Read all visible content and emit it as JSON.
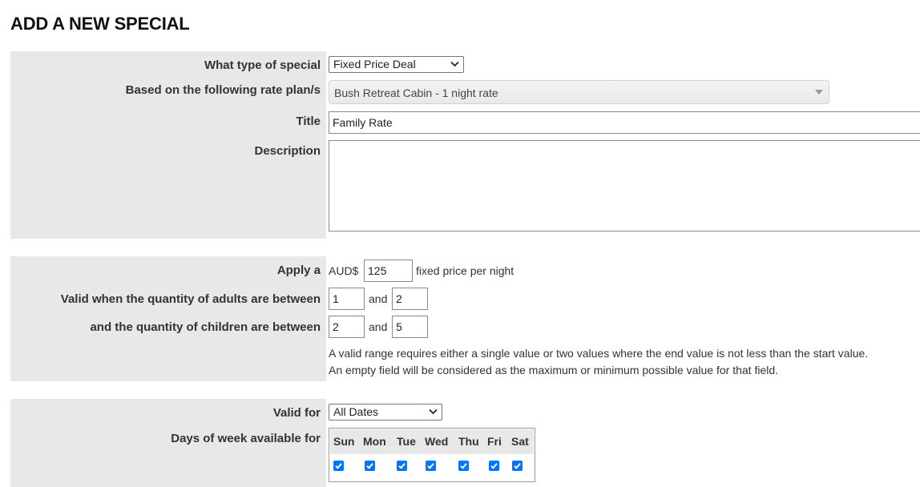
{
  "page": {
    "title": "ADD A NEW SPECIAL"
  },
  "section1": {
    "special_type": {
      "label": "What type of special",
      "value": "Fixed Price Deal"
    },
    "rate_plans": {
      "label": "Based on the following rate plan/s",
      "value": "Bush Retreat Cabin - 1 night rate"
    },
    "title_field": {
      "label": "Title",
      "value": "Family Rate"
    },
    "description": {
      "label": "Description",
      "value": ""
    }
  },
  "section2": {
    "apply": {
      "label": "Apply a",
      "currency": "AUD$",
      "value": "125",
      "suffix": "fixed price per night"
    },
    "adults": {
      "label": "Valid when the quantity of adults are between",
      "min": "1",
      "and_text": "and",
      "max": "2"
    },
    "children": {
      "label": "and the quantity of children are between",
      "min": "2",
      "and_text": "and",
      "max": "5"
    },
    "help_line1": "A valid range requires either a single value or two values where the end value is not less than the start value.",
    "help_line2": "An empty field will be considered as the maximum or minimum possible value for that field."
  },
  "section3": {
    "valid_for": {
      "label": "Valid for",
      "value": "All Dates"
    },
    "days_of_week": {
      "label": "Days of week available for",
      "days": [
        {
          "name": "Sun",
          "checked": true
        },
        {
          "name": "Mon",
          "checked": true
        },
        {
          "name": "Tue",
          "checked": true
        },
        {
          "name": "Wed",
          "checked": true
        },
        {
          "name": "Thu",
          "checked": true
        },
        {
          "name": "Fri",
          "checked": true
        },
        {
          "name": "Sat",
          "checked": true
        }
      ]
    }
  },
  "colors": {
    "label_background": "#e8e8e8",
    "checkbox": "#0075ff"
  }
}
